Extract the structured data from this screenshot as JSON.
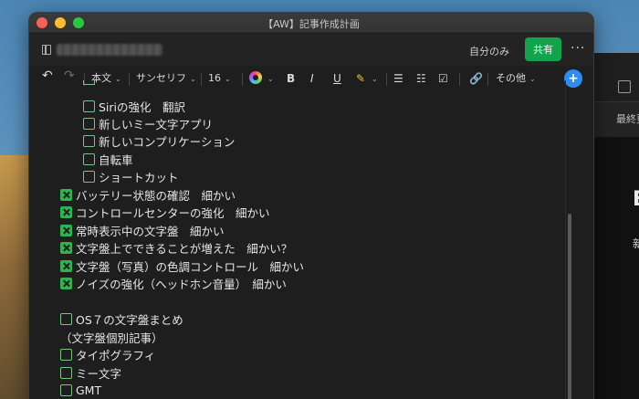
{
  "window": {
    "title": "【AW】記事作成計画"
  },
  "header": {
    "visibility": "自分のみ",
    "share_label": "共有",
    "more": "···"
  },
  "toolbar": {
    "paragraph_style": "本文",
    "font_family": "サンセリフ",
    "font_size": "16",
    "bold": "B",
    "italic": "I",
    "underline": "U",
    "other": "その他",
    "plus": "+"
  },
  "content": {
    "nested_items": [
      {
        "label": "Siriの強化　翻訳",
        "checked": false
      },
      {
        "label": "新しいミー文字アプリ",
        "checked": false
      },
      {
        "label": "新しいコンプリケーション",
        "checked": false
      },
      {
        "label": "自転車",
        "checked": false
      },
      {
        "label": "ショートカット",
        "checked": false
      }
    ],
    "items": [
      {
        "label": "バッテリー状態の確認　細かい",
        "checked": true
      },
      {
        "label": "コントロールセンターの強化　細かい",
        "checked": true
      },
      {
        "label": "常時表示中の文字盤　細かい",
        "checked": true
      },
      {
        "label": "文字盤上でできることが増えた　細かい？",
        "checked": true
      },
      {
        "label": "文字盤（写真）の色調コントロール　細かい",
        "checked": true
      },
      {
        "label": "ノイズの強化（ヘッドホン音量）　細かい",
        "checked": true
      }
    ],
    "os_item": {
      "label": "OS７の文字盤まとめ",
      "checked": false
    },
    "os_note": "（文字盤個別記事）",
    "bottom_items": [
      {
        "label": "タイポグラフィ",
        "checked": false
      },
      {
        "label": "ミー文字",
        "checked": false
      },
      {
        "label": "GMT",
        "checked": false
      }
    ]
  },
  "background_window": {
    "label": "最終更",
    "big": "E",
    "small": "新"
  }
}
